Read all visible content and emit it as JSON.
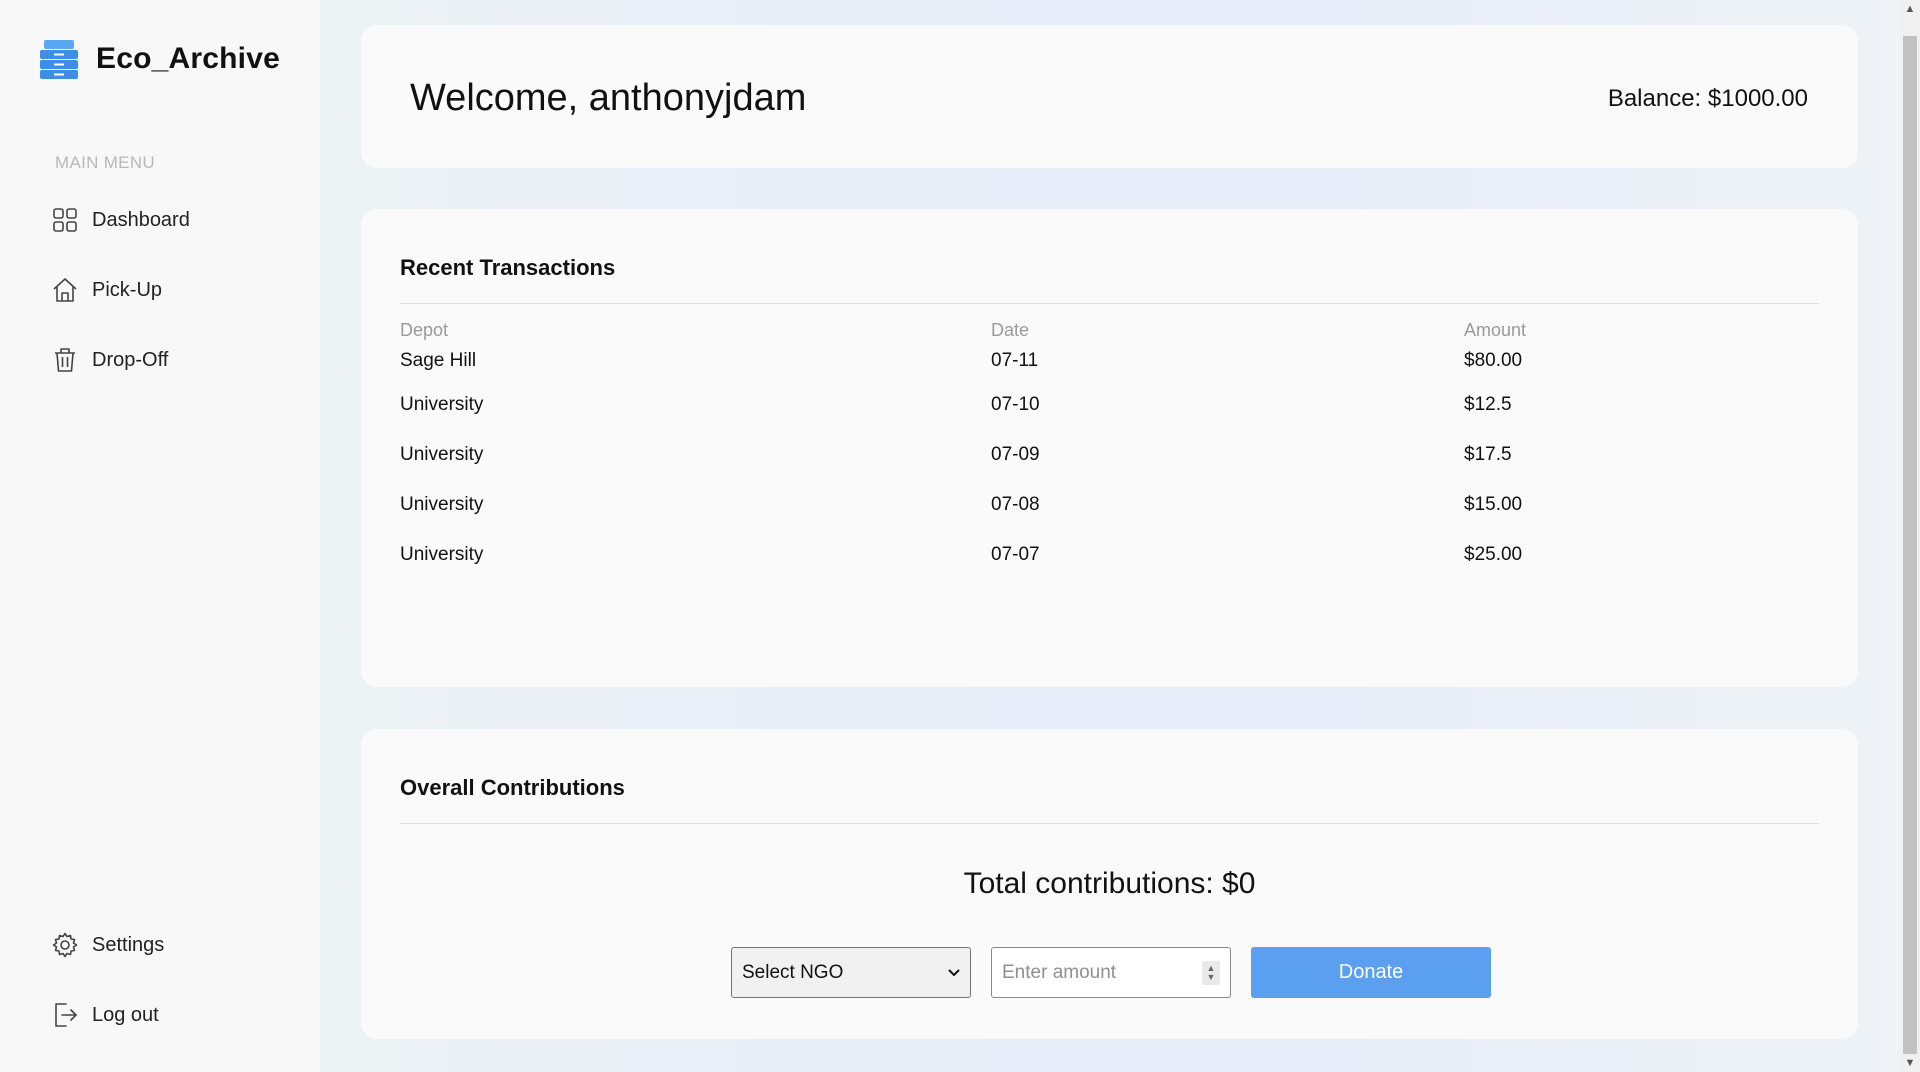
{
  "app": {
    "name": "Eco_Archive"
  },
  "sidebar": {
    "heading": "MAIN MENU",
    "items": [
      {
        "label": "Dashboard",
        "icon": "grid-icon"
      },
      {
        "label": "Pick-Up",
        "icon": "home-icon"
      },
      {
        "label": "Drop-Off",
        "icon": "trash-icon"
      }
    ],
    "bottom_items": [
      {
        "label": "Settings",
        "icon": "gear-icon"
      },
      {
        "label": "Log out",
        "icon": "logout-icon"
      }
    ]
  },
  "header": {
    "welcome": "Welcome, anthonyjdam",
    "balance": "Balance: $1000.00"
  },
  "transactions": {
    "title": "Recent Transactions",
    "columns": [
      "Depot",
      "Date",
      "Amount"
    ],
    "rows": [
      [
        "Sage Hill",
        "07-11",
        "$80.00"
      ],
      [
        "University",
        "07-10",
        "$12.5"
      ],
      [
        "University",
        "07-09",
        "$17.5"
      ],
      [
        "University",
        "07-08",
        "$15.00"
      ],
      [
        "University",
        "07-07",
        "$25.00"
      ]
    ]
  },
  "contributions": {
    "title": "Overall Contributions",
    "total": "Total contributions: $0",
    "select_value": "Select NGO",
    "amount_placeholder": "Enter amount",
    "donate_label": "Donate"
  },
  "colors": {
    "accent": "#5b9ff0",
    "sidebar_bg": "#f7f8f7",
    "card_bg": "#fafafa",
    "logo_blue": "#3d8ee8"
  }
}
